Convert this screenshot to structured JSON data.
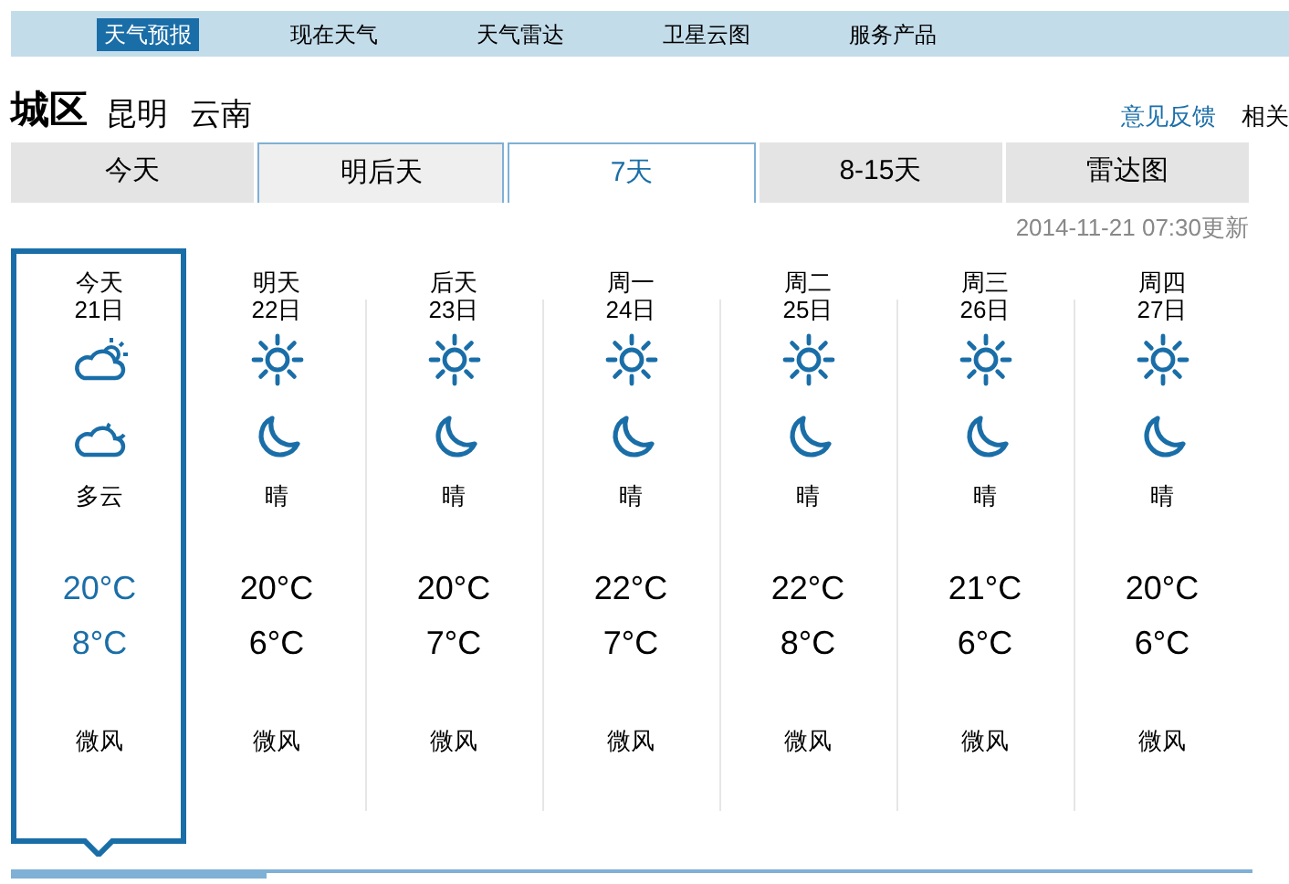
{
  "nav": [
    {
      "label": "天气预报",
      "selected": true
    },
    {
      "label": "现在天气",
      "selected": false
    },
    {
      "label": "天气雷达",
      "selected": false
    },
    {
      "label": "卫星云图",
      "selected": false
    },
    {
      "label": "服务产品",
      "selected": false
    }
  ],
  "location": {
    "district": "城区",
    "city": "昆明",
    "province": "云南"
  },
  "links": [
    "意见反馈",
    "相关"
  ],
  "tabs": [
    {
      "label": "今天",
      "selected": false,
      "hovered": false
    },
    {
      "label": "明后天",
      "selected": false,
      "hovered": true
    },
    {
      "label": "7天",
      "selected": true,
      "hovered": false
    },
    {
      "label": "8-15天",
      "selected": false,
      "hovered": false
    },
    {
      "label": "雷达图",
      "selected": false,
      "hovered": false
    }
  ],
  "updated": "2014-11-21 07:30更新",
  "days": [
    {
      "day": "今天",
      "date": "21日",
      "icons": [
        {
          "kind": "partly-cloudy"
        },
        {
          "kind": "cloudy-night"
        }
      ],
      "weather": "多云",
      "high": "20°C",
      "low": "8°C",
      "wind": "微风",
      "selected": true
    },
    {
      "day": "明天",
      "date": "22日",
      "icons": [
        {
          "kind": "sunny"
        },
        {
          "kind": "moon"
        }
      ],
      "weather": "晴",
      "high": "20°C",
      "low": "6°C",
      "wind": "微风",
      "selected": false
    },
    {
      "day": "后天",
      "date": "23日",
      "icons": [
        {
          "kind": "sunny"
        },
        {
          "kind": "moon"
        }
      ],
      "weather": "晴",
      "high": "20°C",
      "low": "7°C",
      "wind": "微风",
      "selected": false
    },
    {
      "day": "周一",
      "date": "24日",
      "icons": [
        {
          "kind": "sunny"
        },
        {
          "kind": "moon"
        }
      ],
      "weather": "晴",
      "high": "22°C",
      "low": "7°C",
      "wind": "微风",
      "selected": false
    },
    {
      "day": "周二",
      "date": "25日",
      "icons": [
        {
          "kind": "sunny"
        },
        {
          "kind": "moon"
        }
      ],
      "weather": "晴",
      "high": "22°C",
      "low": "8°C",
      "wind": "微风",
      "selected": false
    },
    {
      "day": "周三",
      "date": "26日",
      "icons": [
        {
          "kind": "sunny"
        },
        {
          "kind": "moon"
        }
      ],
      "weather": "晴",
      "high": "21°C",
      "low": "6°C",
      "wind": "微风",
      "selected": false
    },
    {
      "day": "周四",
      "date": "27日",
      "icons": [
        {
          "kind": "sunny"
        },
        {
          "kind": "moon"
        }
      ],
      "weather": "晴",
      "high": "20°C",
      "low": "6°C",
      "wind": "微风",
      "selected": false
    }
  ]
}
